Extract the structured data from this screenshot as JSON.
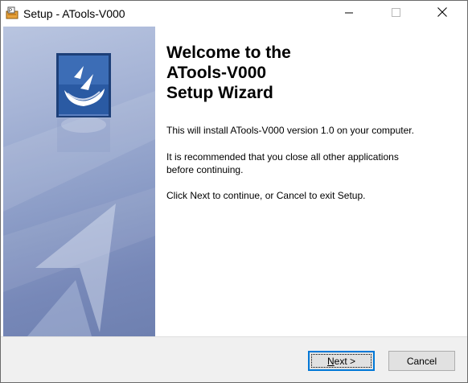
{
  "window": {
    "title": "Setup - ATools-V000"
  },
  "titlebar": {
    "minimize_label": "Minimize",
    "maximize_label": "Maximize",
    "close_label": "Close"
  },
  "main": {
    "heading_line1": "Welcome to the",
    "heading_line2": "ATools-V000",
    "heading_line3": "Setup Wizard",
    "paragraph1": "This will install ATools-V000 version 1.0 on your computer.",
    "paragraph2_line1": "It is recommended that you close all other applications",
    "paragraph2_line2": "before continuing.",
    "paragraph3": "Click Next to continue, or Cancel to exit Setup."
  },
  "buttons": {
    "next_accel": "N",
    "next_rest": "ext >",
    "cancel_label": "Cancel"
  },
  "colors": {
    "accent": "#0078d7",
    "panel_top": "#b9c5e0",
    "panel_bottom": "#6e80b0",
    "logo_blue": "#1f4e8c"
  },
  "icons": {
    "app": "setup-app-icon",
    "logo": "setup-wizard-logo-icon"
  }
}
